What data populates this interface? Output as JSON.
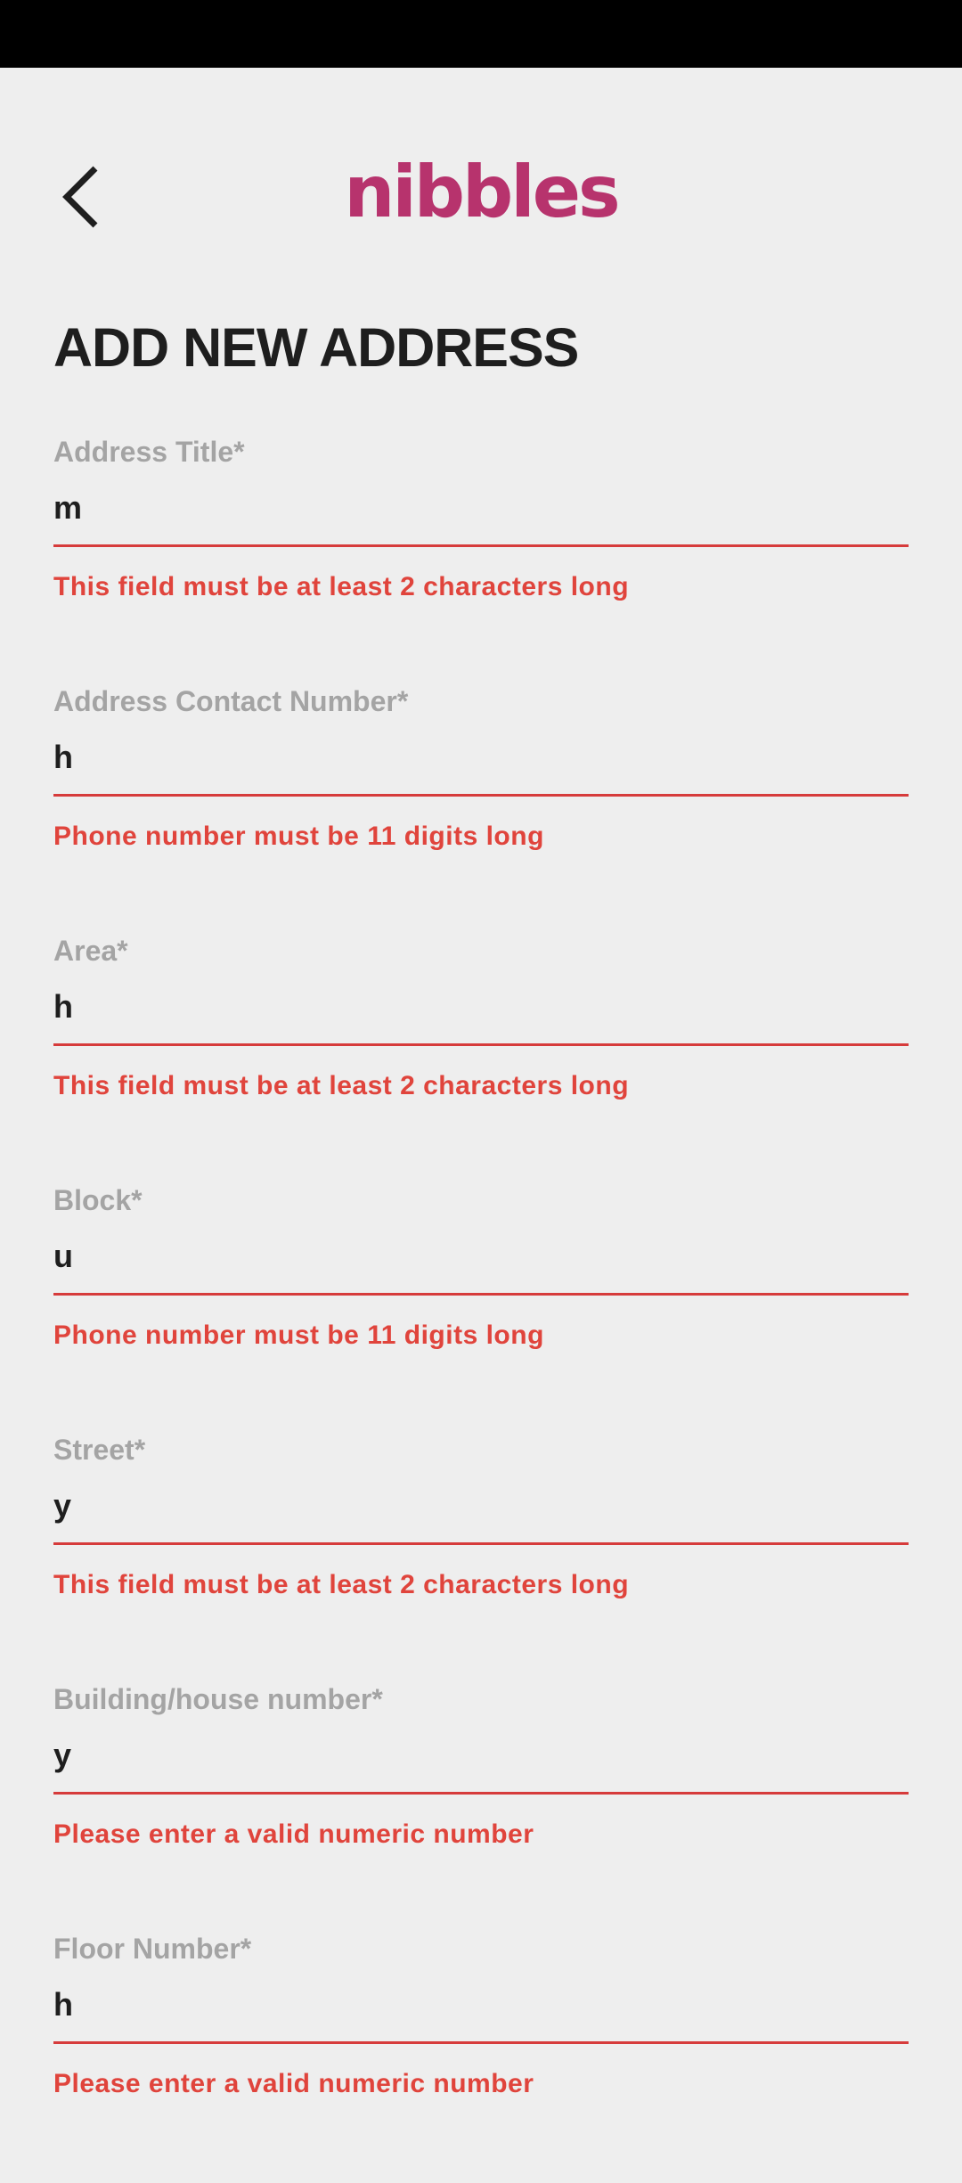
{
  "header": {
    "logo_text": "nibbles",
    "back_icon": "chevron-left-icon"
  },
  "page": {
    "title": "ADD NEW ADDRESS"
  },
  "form": {
    "fields": [
      {
        "label": "Address Title*",
        "value": "m",
        "error": "This field must be at least 2 characters long"
      },
      {
        "label": "Address Contact Number*",
        "value": "h",
        "error": "Phone number must be 11 digits long"
      },
      {
        "label": "Area*",
        "value": "h",
        "error": "This field must be at least 2 characters long"
      },
      {
        "label": "Block*",
        "value": "u",
        "error": "Phone number must be 11 digits long"
      },
      {
        "label": "Street*",
        "value": "y",
        "error": "This field must be at least 2 characters long"
      },
      {
        "label": "Building/house number*",
        "value": "y",
        "error": "Please enter a valid numeric number"
      },
      {
        "label": "Floor Number*",
        "value": "h",
        "error": "Please enter a valid numeric number"
      }
    ]
  },
  "colors": {
    "background": "#eeeeee",
    "status_bar": "#000000",
    "brand": "#b7336d",
    "error": "#e0443c",
    "error_underline": "#d63b3b",
    "label": "#a4a4a4",
    "text": "#1e1e1e"
  }
}
